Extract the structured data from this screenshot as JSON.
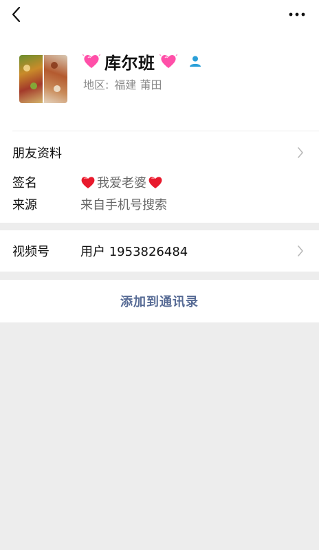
{
  "nav": {
    "back_icon": "chevron-left-icon",
    "more_icon": "more-dots-icon"
  },
  "profile": {
    "name": "库尔班",
    "name_decoration_icon": "pink-heart-icon",
    "badge_icon": "contact-person-icon",
    "region_label": "地区:",
    "region_value": "福建 莆田"
  },
  "friend_info": {
    "label": "朋友资料"
  },
  "signature": {
    "label": "签名",
    "text": "我爱老婆",
    "emoji_icon": "red-heart-icon"
  },
  "source": {
    "label": "来源",
    "value": "来自手机号搜索"
  },
  "channel": {
    "label": "视频号",
    "value": "用户 1953826484"
  },
  "add_contact": {
    "label": "添加到通讯录"
  },
  "colors": {
    "background": "#ededed",
    "card": "#ffffff",
    "link_blue": "#576b95",
    "muted_text": "#8a8a8a",
    "badge_blue": "#2a9fd8",
    "pink_heart": "#ff4fa8",
    "red_heart": "#e8192c"
  }
}
